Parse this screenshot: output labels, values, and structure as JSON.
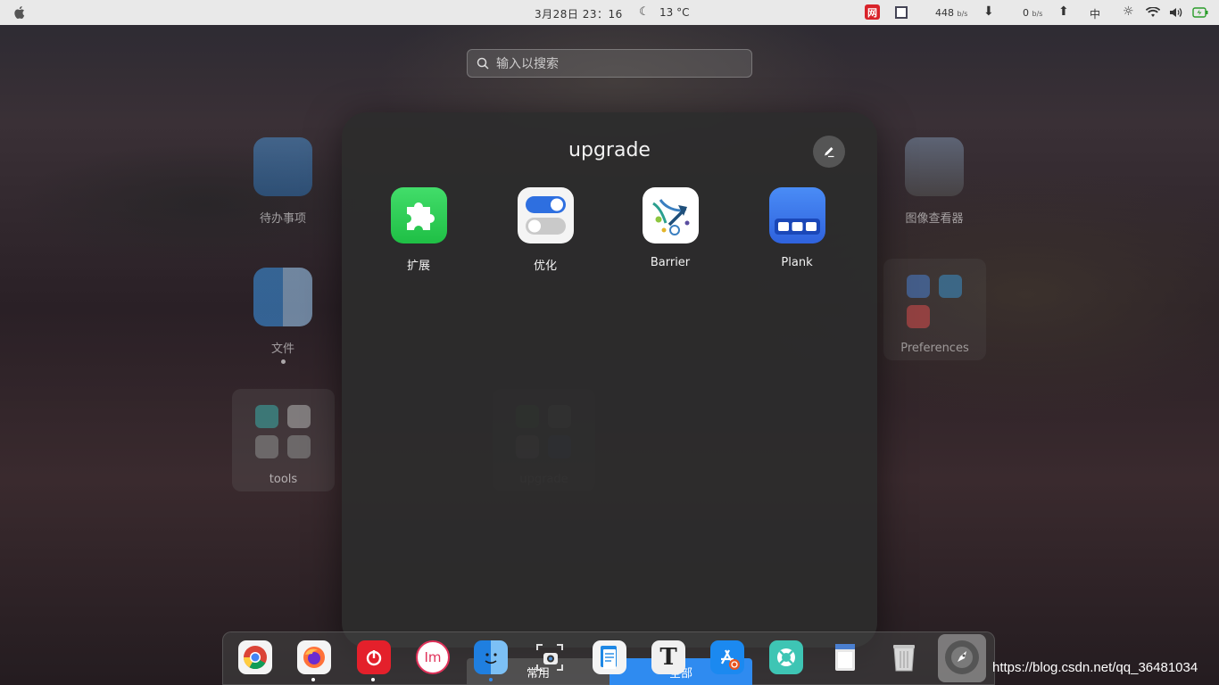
{
  "topbar": {
    "clock": "3月28日  23：16",
    "temperature": "13 °C",
    "net_down_value": "448",
    "net_down_unit": "b/s",
    "net_up_value": "0",
    "net_up_unit": "b/s",
    "input_method": "中"
  },
  "search": {
    "placeholder": "输入以搜索"
  },
  "background_apps": {
    "todo": "待办事项",
    "files": "文件",
    "image_viewer": "图像查看器",
    "tools_folder": "tools",
    "preferences_folder": "Preferences",
    "upgrade_folder": "upgrade",
    "hidden_folder_1": "",
    "hidden_folder_2": "",
    "hidden_folder_3": ""
  },
  "folder_popup": {
    "title": "upgrade",
    "apps": [
      {
        "label": "扩展",
        "icon": "puzzle-icon",
        "color": "#2fd15a"
      },
      {
        "label": "优化",
        "icon": "toggles-icon",
        "color": "#f2f2f2"
      },
      {
        "label": "Barrier",
        "icon": "barrier-icon",
        "color": "#ffffff"
      },
      {
        "label": "Plank",
        "icon": "plank-icon",
        "color": "#3a7bf2"
      }
    ]
  },
  "dock": {
    "tabs": {
      "common": "常用",
      "all": "全部"
    },
    "items": [
      "chrome-icon",
      "firefox-icon",
      "netease-music-icon",
      "im-icon",
      "finder-icon",
      "screenshot-icon",
      "document-viewer-icon",
      "font-icon",
      "app-store-icon",
      "lifebuoy-icon",
      "notes-icon",
      "trash-icon",
      "launchpad-icon"
    ]
  },
  "watermark": "https://blog.csdn.net/qq_36481034",
  "colors": {
    "accent": "#2f8bf0",
    "popup_bg": "#2c2c2c"
  }
}
